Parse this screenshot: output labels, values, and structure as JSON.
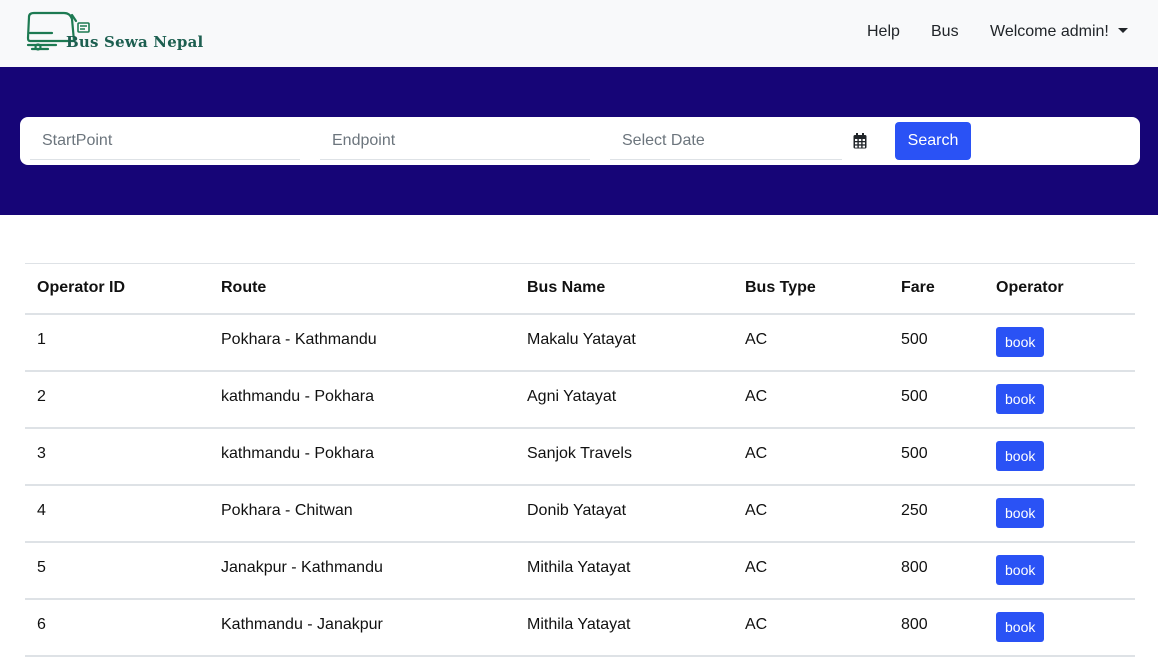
{
  "brand": {
    "name": "Bus Sewa Nepal",
    "color": "#1d5f50"
  },
  "nav": {
    "help": "Help",
    "bus": "Bus",
    "user": "Welcome admin!"
  },
  "search": {
    "start_placeholder": "StartPoint",
    "end_placeholder": "Endpoint",
    "date_placeholder": "Select Date",
    "button": "Search"
  },
  "colors": {
    "banner": "#160577",
    "accent": "#2a52f5",
    "navbar": "#f8f9fa"
  },
  "table": {
    "headers": [
      "Operator ID",
      "Route",
      "Bus Name",
      "Bus Type",
      "Fare",
      "Operator"
    ],
    "rows": [
      {
        "id": "1",
        "route": "Pokhara - Kathmandu",
        "bus": "Makalu Yatayat",
        "type": "AC",
        "fare": "500",
        "action": "book"
      },
      {
        "id": "2",
        "route": "kathmandu - Pokhara",
        "bus": "Agni Yatayat",
        "type": "AC",
        "fare": "500",
        "action": "book"
      },
      {
        "id": "3",
        "route": "kathmandu - Pokhara",
        "bus": "Sanjok Travels",
        "type": "AC",
        "fare": "500",
        "action": "book"
      },
      {
        "id": "4",
        "route": "Pokhara - Chitwan",
        "bus": "Donib Yatayat",
        "type": "AC",
        "fare": "250",
        "action": "book"
      },
      {
        "id": "5",
        "route": "Janakpur - Kathmandu",
        "bus": "Mithila Yatayat",
        "type": "AC",
        "fare": "800",
        "action": "book"
      },
      {
        "id": "6",
        "route": "Kathmandu - Janakpur",
        "bus": "Mithila Yatayat",
        "type": "AC",
        "fare": "800",
        "action": "book"
      }
    ]
  }
}
